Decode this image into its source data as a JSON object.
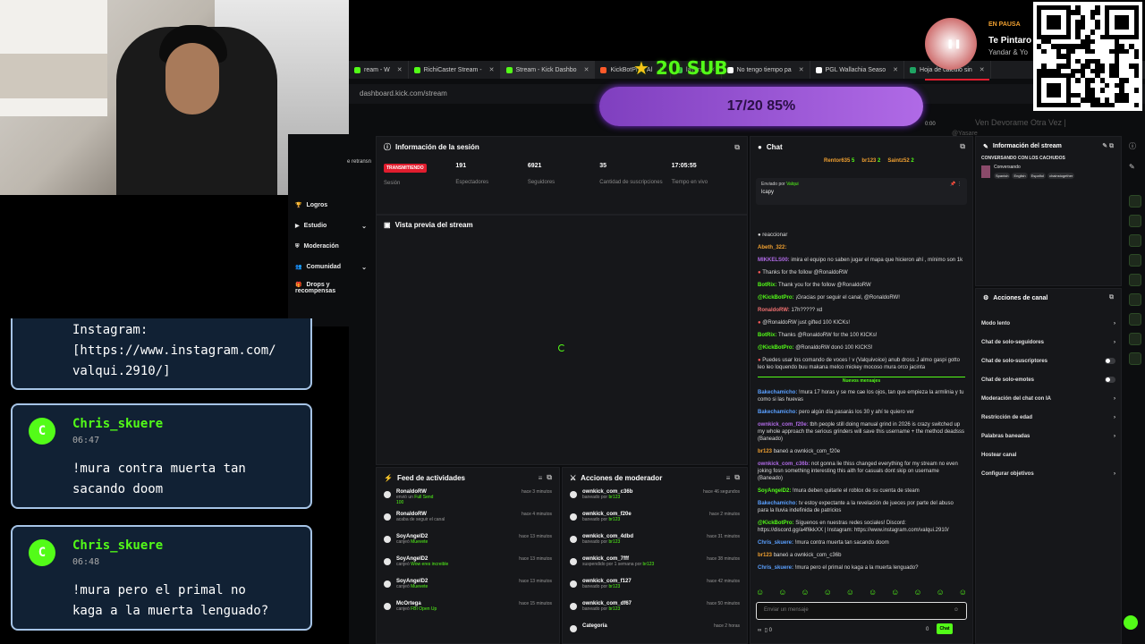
{
  "tabs": [
    {
      "label": "ream - W",
      "color": "#53fc18",
      "active": false
    },
    {
      "label": "RichiCaster Stream -",
      "color": "#53fc18",
      "active": false
    },
    {
      "label": "Stream - Kick Dashbo",
      "color": "#53fc18",
      "active": true
    },
    {
      "label": "KickBotPro - Al",
      "color": "#ff5a2a",
      "active": false
    },
    {
      "label": "layers",
      "color": "#3fd64f",
      "active": false
    },
    {
      "label": "No tengo tiempo pa",
      "color": "#ffffff",
      "active": false
    },
    {
      "label": "PGL Wallachia Seaso",
      "color": "#ffffff",
      "active": false
    },
    {
      "label": "Hoja de cálculo sin",
      "color": "#1fa463",
      "active": false
    }
  ],
  "url": "dashboard.kick.com/stream",
  "nav": {
    "partial": "e retransn",
    "items": [
      {
        "label": "Logros",
        "icon": "trophy-icon",
        "chevron": false
      },
      {
        "label": "Estudio",
        "icon": "video-icon",
        "chevron": true
      },
      {
        "label": "Moderación",
        "icon": "shield-icon",
        "chevron": false
      },
      {
        "label": "Comunidad",
        "icon": "users-icon",
        "chevron": true
      },
      {
        "label": "Drops y recompensas",
        "icon": "gift-icon",
        "chevron": false
      }
    ]
  },
  "session": {
    "title": "Información de la sesión",
    "status_badge": "TRANSMITIENDO",
    "stats": [
      {
        "value": "",
        "label": "Sesión"
      },
      {
        "value": "191",
        "label": "Espectadores"
      },
      {
        "value": "6921",
        "label": "Seguidores"
      },
      {
        "value": "35",
        "label": "Cantidad de suscripciones"
      },
      {
        "value": "17:05:55",
        "label": "Tiempo en vivo"
      }
    ]
  },
  "preview": {
    "title": "Vista previa del stream"
  },
  "chat": {
    "title": "Chat",
    "top_users": [
      {
        "name": "Rentor635",
        "extra": "5"
      },
      {
        "name": "br123",
        "extra": "2"
      },
      {
        "name": "Saintz52",
        "extra": "2"
      }
    ],
    "pinned_by": "Enviado por",
    "pinned_user": "Valqui",
    "pinned_text": "lcapy",
    "messages": [
      {
        "user": "",
        "text": "reaccionar",
        "color": "#dcdcdc"
      },
      {
        "user": "Abeth_322:",
        "text": "",
        "color": "#f0a030"
      },
      {
        "user": "MIKKELS00:",
        "text": "imira el equipo no saben jugar el mapa que hicieron ahí , mínimo son 1k",
        "color": "#b06ae6"
      },
      {
        "user": "",
        "text": "Thanks for the follow @RonaldoRW",
        "color": "#ff5a5a"
      },
      {
        "user": "BotRix:",
        "text": "Thank you for the follow @RonaldoRW",
        "color": "#53fc18"
      },
      {
        "user": "@KickBotPro:",
        "text": "¡Gracias por seguir el canal, @RonaldoRW!",
        "color": "#53fc18"
      },
      {
        "user": "RonaldoRW:",
        "text": "17h????? xd",
        "color": "#f07070"
      },
      {
        "user": "",
        "text": "@RonaldoRW just gifted 100 KICKs!",
        "color": "#ff5a5a"
      },
      {
        "user": "BotRix:",
        "text": "Thanks @RonaldoRW for the 100 KICKs!",
        "color": "#53fc18"
      },
      {
        "user": "@KickBotPro:",
        "text": "@RonaldoRW donó 100 KICKS!",
        "color": "#53fc18"
      },
      {
        "user": "",
        "text": "Puedes usar los comando de voces ! v (Valquivoice) anub dross J almo gaspi gotto leo leo loquendo buu makana melco mickey mocoso mura orco jacinta",
        "color": "#ff5a5a"
      }
    ],
    "new_messages": "Nuevos mensajes",
    "messages2": [
      {
        "user": "Bakechamicho:",
        "text": "!mura 17 horas y se me cae los ojos, tan que empieza la armlinia y tu como si las huevas",
        "color": "#5aa0ff"
      },
      {
        "user": "Bakechamicho:",
        "text": "pero algún día pasarás los 30 y ahí te quiero ver",
        "color": "#5aa0ff"
      },
      {
        "user": "ownkick_com_f20e:",
        "text": "tbh people still doing manual grind in 2026 is crazy switched up my whole approach the serious grinders will save this username + the method deadsss (Baneado)",
        "color": "#b06ae6"
      },
      {
        "user": "br123",
        "text": "baneó a ownkick_com_f20e",
        "color": "#f0a030"
      },
      {
        "user": "ownkick_com_c36b:",
        "text": "not gonna lie thiss changed everything for my stream no even joking fosn something interesting this aith for casuals dont skip on username (Baneado)",
        "color": "#b06ae6"
      },
      {
        "user": "SoyAngelD2:",
        "text": "!mura deben quitarle el roblox de su cuenta de steam",
        "color": "#53fc18"
      },
      {
        "user": "Bakechamicho:",
        "text": "tv estoy expectante a la revelación de jueces por parte del abuso para la lluvia indefinida de patricios",
        "color": "#5aa0ff"
      },
      {
        "user": "@KickBotPro:",
        "text": "Síguenos en nuestras redes sociales! Discord: https://discord.gg/a4f6kkXX | Instagram: https://www.instagram.com/valqui.2910/",
        "color": "#53fc18"
      },
      {
        "user": "Chris_skuere:",
        "text": "!mura contra muerta tan sacando doom",
        "color": "#5aa0ff"
      },
      {
        "user": "br123",
        "text": "baneó a ownkick_com_c36b",
        "color": "#f0a030"
      },
      {
        "user": "Chris_skuere:",
        "text": "!mura pero el primal no kaga a la muerta lenguado?",
        "color": "#5aa0ff"
      }
    ],
    "input_placeholder": "Enviar un mensaje",
    "send_label": "Chat",
    "footer_left": "∞",
    "footer_count": "0",
    "footer_right": "0"
  },
  "activity": {
    "title": "Feed de actividades",
    "rows": [
      {
        "name": "RonaldoRW",
        "action": "envió un",
        "highlight": "Full Send",
        "extra": "100",
        "time": "hace 3 minutos"
      },
      {
        "name": "RonaldoRW",
        "action": "acaba de seguir el canal",
        "highlight": "",
        "extra": "",
        "time": "hace 4 minutos"
      },
      {
        "name": "SoyAngelD2",
        "action": "canjeó",
        "highlight": "Muevete",
        "extra": "",
        "time": "hace 13 minutos"
      },
      {
        "name": "SoyAngelD2",
        "action": "canjeó",
        "highlight": "Wow eres increible",
        "extra": "",
        "time": "hace 13 minutos"
      },
      {
        "name": "SoyAngelD2",
        "action": "canjeó",
        "highlight": "Muevete",
        "extra": "",
        "time": "hace 13 minutos"
      },
      {
        "name": "McOrtega",
        "action": "canjeó",
        "highlight": "FBI Open Up",
        "extra": "",
        "time": "hace 15 minutos"
      }
    ]
  },
  "modactions": {
    "title": "Acciones de moderador",
    "rows": [
      {
        "name": "ownkick_com_c36b",
        "action": "baneado por",
        "by": "br123",
        "time": "hace 46 segundos"
      },
      {
        "name": "ownkick_com_f20e",
        "action": "baneado por",
        "by": "br123",
        "time": "hace 2 minutos"
      },
      {
        "name": "ownkick_com_4dbd",
        "action": "baneado por",
        "by": "br123",
        "time": "hace 31 minutos"
      },
      {
        "name": "ownkick_com_7fff",
        "action": "suspendido por 1 semana por",
        "by": "br123",
        "time": "hace 38 minutos"
      },
      {
        "name": "ownkick_com_f127",
        "action": "baneado por",
        "by": "br123",
        "time": "hace 42 minutos"
      },
      {
        "name": "ownkick_com_df67",
        "action": "baneado por",
        "by": "br123",
        "time": "hace 50 minutos"
      },
      {
        "name": "Categoría",
        "action": "",
        "by": "",
        "time": "hace 2 horas"
      }
    ]
  },
  "streaminfo": {
    "title": "Información del stream",
    "stream_title": "CONVERSANDO CON LOS CACHUDOS",
    "category": "Conversando",
    "tags": [
      "Spanish",
      "English",
      "Español",
      "chainstogether"
    ]
  },
  "channel_actions": {
    "title": "Acciones de canal",
    "items": [
      {
        "label": "Modo lento",
        "type": "chevron"
      },
      {
        "label": "Chat de solo-seguidores",
        "type": "chevron"
      },
      {
        "label": "Chat de solo-suscriptores",
        "type": "toggle"
      },
      {
        "label": "Chat de solo-emotes",
        "type": "toggle"
      },
      {
        "label": "Moderación del chat con IA",
        "type": "chevron"
      },
      {
        "label": "Restricción de edad",
        "type": "chevron"
      },
      {
        "label": "Palabras baneadas",
        "type": "chevron"
      },
      {
        "label": "Hostear canal",
        "type": "none"
      },
      {
        "label": "Configurar objetivos",
        "type": "chevron"
      }
    ]
  },
  "overlay": {
    "partial_bubble": "Instagram:\n[https://www.instagram.com/\nvalqui.2910/]",
    "bubbles": [
      {
        "initial": "C",
        "name": "Chris_skuere",
        "time": "06:47",
        "text": "!mura contra muerta tan\nsacando doom"
      },
      {
        "initial": "C",
        "name": "Chris_skuere",
        "time": "06:48",
        "text": "!mura pero el primal no\nkaga a la muerta lenguado?"
      }
    ],
    "sub_goal": "20 SUB",
    "sub_progress_text": "17/20 85%",
    "sub_progress": 0.85,
    "music": {
      "status": "EN PAUSA",
      "song": "Te Pintaro",
      "artist": "Yandar & Yo",
      "faded": "Ven Devorame Otra Vez |",
      "requester": "@Yasare",
      "time": "0:00"
    }
  },
  "colors": {
    "kick_green": "#53fc18",
    "panel": "#16171a",
    "live_red": "#e11d2e",
    "purple": "#9b4fd8"
  }
}
